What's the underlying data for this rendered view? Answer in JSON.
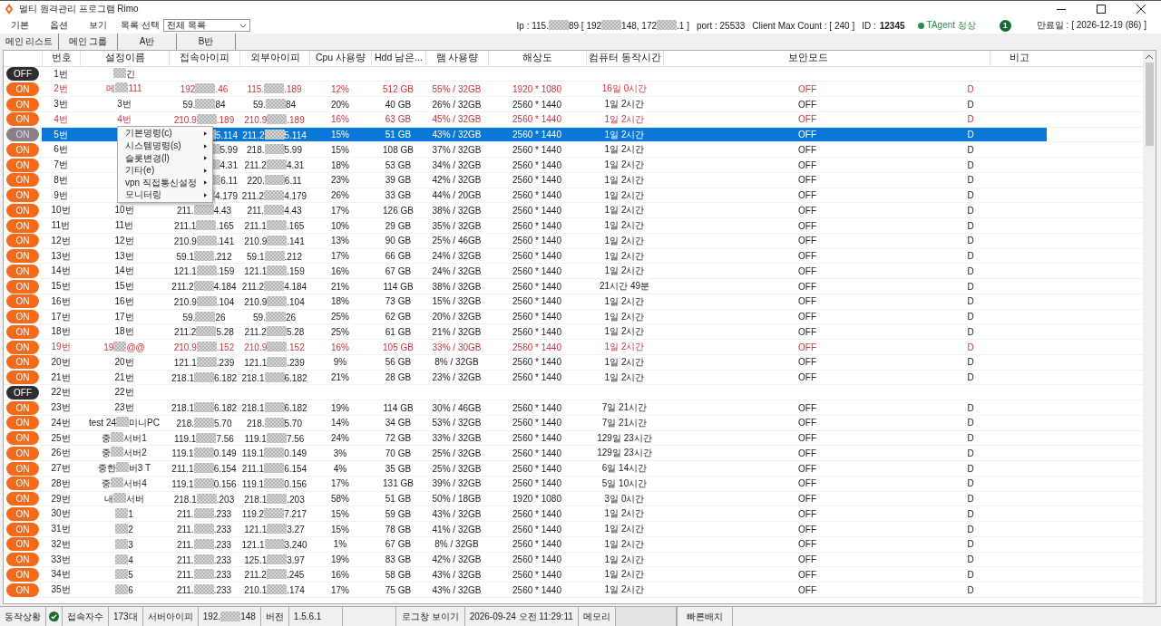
{
  "window": {
    "title": "멀티 원격관리 프로그램 Rimo"
  },
  "menu": [
    "기본",
    "옵션",
    "보기"
  ],
  "list_select": {
    "label": "목록 선택",
    "value": "전체 목록"
  },
  "info": {
    "ip": [
      "Ip : 115.",
      {
        "kind": "mask"
      },
      "89 [ 192",
      {
        "kind": "mask"
      },
      "148, 172",
      {
        "kind": "mask"
      },
      ".1 ]"
    ],
    "port": "port : 25533",
    "max_count": "Client Max Count :  [ 240 ]",
    "id_label": "ID :",
    "id": "12345",
    "agent": "TAgent 정상",
    "badge": "1",
    "expiry": "만료일 : [ 2026-12-19 (86) ]"
  },
  "tabs": [
    "메인 리스트",
    "메인 그룹",
    "A반",
    "B반"
  ],
  "columns": [
    {
      "kind": "blank"
    },
    {
      "kind": "text",
      "label": "번호"
    },
    {
      "kind": "text",
      "label": "설정이름"
    },
    {
      "kind": "text",
      "label": "접속아이피"
    },
    {
      "kind": "text",
      "label": "외부아이피"
    },
    {
      "kind": "text",
      "label": "Cpu 사용량"
    },
    {
      "kind": "text",
      "label": "Hdd 남은..."
    },
    {
      "kind": "text",
      "label": "램 사용량"
    },
    {
      "kind": "text",
      "label": "해상도"
    },
    {
      "kind": "text",
      "label": "컴퓨터 동작시간"
    },
    {
      "kind": "text",
      "label": "보안모드"
    },
    {
      "kind": "blank"
    },
    {
      "kind": "text",
      "label": "비고"
    }
  ],
  "rows": [
    {
      "status": "OFF",
      "on": false,
      "alert": false,
      "selected": false,
      "no": "1번",
      "name": [
        {
          "kind": "mask"
        },
        "긴"
      ]
    },
    {
      "status": "ON",
      "on": true,
      "alert": true,
      "selected": false,
      "no": "2번",
      "name": [
        "메",
        {
          "kind": "mask"
        },
        "111"
      ],
      "ip_local": [
        "192",
        {
          "kind": "mask"
        },
        ".46"
      ],
      "ip_external": [
        "115.",
        {
          "kind": "mask"
        },
        ".189"
      ],
      "cpu": "12%",
      "hdd": "512 GB",
      "ram": "55% / 32GB",
      "resolution": "1920 * 1080",
      "uptime": "16일 0시간",
      "security": "OFF",
      "column_12": "D"
    },
    {
      "status": "ON",
      "on": true,
      "alert": false,
      "selected": false,
      "no": "3번",
      "name": [
        "3번"
      ],
      "ip_local": [
        "59.",
        {
          "kind": "mask"
        },
        "84"
      ],
      "ip_external": [
        "59.",
        {
          "kind": "mask"
        },
        "84"
      ],
      "cpu": "20%",
      "hdd": "40 GB",
      "ram": "26% / 32GB",
      "resolution": "2560 * 1440",
      "uptime": "1일 2시간",
      "security": "OFF",
      "column_12": "D"
    },
    {
      "status": "ON",
      "on": true,
      "alert": true,
      "selected": false,
      "no": "4번",
      "name": [
        "4번"
      ],
      "ip_local": [
        "210.9",
        {
          "kind": "mask"
        },
        ".189"
      ],
      "ip_external": [
        "210.9",
        {
          "kind": "mask"
        },
        ".189"
      ],
      "cpu": "16%",
      "hdd": "63 GB",
      "ram": "45% / 32GB",
      "resolution": "2560 * 1440",
      "uptime": "1일 2시간",
      "security": "OFF",
      "column_12": "D"
    },
    {
      "status": "ON",
      "on": true,
      "alert": false,
      "selected": true,
      "no": "5번",
      "ip_local": [
        {
          "kind": "mask"
        },
        "5.114"
      ],
      "ip_external": [
        "211.2",
        {
          "kind": "mask"
        },
        "5.114"
      ],
      "cpu": "15%",
      "hdd": "51 GB",
      "ram": "43% / 32GB",
      "resolution": "2560 * 1440",
      "uptime": "1일 2시간",
      "security": "OFF",
      "column_12": "D"
    },
    {
      "status": "ON",
      "on": true,
      "alert": false,
      "selected": false,
      "no": "6번",
      "ip_local": [
        {
          "kind": "mask"
        },
        "5.99"
      ],
      "ip_external": [
        "218.",
        {
          "kind": "mask"
        },
        "5.99"
      ],
      "cpu": "15%",
      "hdd": "108 GB",
      "ram": "37% / 32GB",
      "resolution": "2560 * 1440",
      "uptime": "1일 2시간",
      "security": "OFF",
      "column_12": "D"
    },
    {
      "status": "ON",
      "on": true,
      "alert": false,
      "selected": false,
      "no": "7번",
      "ip_local": [
        {
          "kind": "mask"
        },
        "4.31"
      ],
      "ip_external": [
        "211.2",
        {
          "kind": "mask"
        },
        "4.31"
      ],
      "cpu": "18%",
      "hdd": "53 GB",
      "ram": "34% / 32GB",
      "resolution": "2560 * 1440",
      "uptime": "1일 2시간",
      "security": "OFF",
      "column_12": "D"
    },
    {
      "status": "ON",
      "on": true,
      "alert": false,
      "selected": false,
      "no": "8번",
      "ip_local": [
        {
          "kind": "mask"
        },
        "6.11"
      ],
      "ip_external": [
        "220.",
        {
          "kind": "mask"
        },
        "6.11"
      ],
      "cpu": "23%",
      "hdd": "39 GB",
      "ram": "42% / 32GB",
      "resolution": "2560 * 1440",
      "uptime": "1일 2시간",
      "security": "OFF",
      "column_12": "D"
    },
    {
      "status": "ON",
      "on": true,
      "alert": false,
      "selected": false,
      "no": "9번",
      "ip_local": [
        {
          "kind": "mask"
        },
        "4.179"
      ],
      "ip_external": [
        "211.2",
        {
          "kind": "mask"
        },
        "4.179"
      ],
      "cpu": "26%",
      "hdd": "33 GB",
      "ram": "44% / 20GB",
      "resolution": "2560 * 1440",
      "uptime": "1일 2시간",
      "security": "OFF",
      "column_12": "D"
    },
    {
      "status": "ON",
      "on": true,
      "alert": false,
      "selected": false,
      "no": "10번",
      "name": [
        "10번"
      ],
      "ip_local": [
        "211.",
        {
          "kind": "mask"
        },
        "4.43"
      ],
      "ip_external": [
        "211.",
        {
          "kind": "mask"
        },
        "4.43"
      ],
      "cpu": "17%",
      "hdd": "126 GB",
      "ram": "38% / 32GB",
      "resolution": "2560 * 1440",
      "uptime": "1일 2시간",
      "security": "OFF",
      "column_12": "D"
    },
    {
      "status": "ON",
      "on": true,
      "alert": false,
      "selected": false,
      "no": "11번",
      "name": [
        "11번"
      ],
      "ip_local": [
        "211.1",
        {
          "kind": "mask"
        },
        ".165"
      ],
      "ip_external": [
        "211.1",
        {
          "kind": "mask"
        },
        ".165"
      ],
      "cpu": "10%",
      "hdd": "29 GB",
      "ram": "35% / 32GB",
      "resolution": "2560 * 1440",
      "uptime": "1일 2시간",
      "security": "OFF",
      "column_12": "D"
    },
    {
      "status": "ON",
      "on": true,
      "alert": false,
      "selected": false,
      "no": "12번",
      "name": [
        "12번"
      ],
      "ip_local": [
        "210.9",
        {
          "kind": "mask"
        },
        ".141"
      ],
      "ip_external": [
        "210.9",
        {
          "kind": "mask"
        },
        ".141"
      ],
      "cpu": "13%",
      "hdd": "90 GB",
      "ram": "25% / 46GB",
      "resolution": "2560 * 1440",
      "uptime": "1일 2시간",
      "security": "OFF",
      "column_12": "D"
    },
    {
      "status": "ON",
      "on": true,
      "alert": false,
      "selected": false,
      "no": "13번",
      "name": [
        "13번"
      ],
      "ip_local": [
        "59.1",
        {
          "kind": "mask"
        },
        ".212"
      ],
      "ip_external": [
        "59.1",
        {
          "kind": "mask"
        },
        ".212"
      ],
      "cpu": "17%",
      "hdd": "66 GB",
      "ram": "24% / 32GB",
      "resolution": "2560 * 1440",
      "uptime": "1일 2시간",
      "security": "OFF",
      "column_12": "D"
    },
    {
      "status": "ON",
      "on": true,
      "alert": false,
      "selected": false,
      "no": "14번",
      "name": [
        "14번"
      ],
      "ip_local": [
        "121.1",
        {
          "kind": "mask"
        },
        ".159"
      ],
      "ip_external": [
        "121.1",
        {
          "kind": "mask"
        },
        ".159"
      ],
      "cpu": "16%",
      "hdd": "67 GB",
      "ram": "24% / 32GB",
      "resolution": "2560 * 1440",
      "uptime": "1일 2시간",
      "security": "OFF",
      "column_12": "D"
    },
    {
      "status": "ON",
      "on": true,
      "alert": false,
      "selected": false,
      "no": "15번",
      "name": [
        "15번"
      ],
      "ip_local": [
        "211.2",
        {
          "kind": "mask"
        },
        "4.184"
      ],
      "ip_external": [
        "211.2",
        {
          "kind": "mask"
        },
        "4.184"
      ],
      "cpu": "21%",
      "hdd": "114 GB",
      "ram": "38% / 32GB",
      "resolution": "2560 * 1440",
      "uptime": "21시간 49분",
      "security": "OFF",
      "column_12": "D"
    },
    {
      "status": "ON",
      "on": true,
      "alert": false,
      "selected": false,
      "no": "16번",
      "name": [
        "16번"
      ],
      "ip_local": [
        "210.9",
        {
          "kind": "mask"
        },
        ".104"
      ],
      "ip_external": [
        "210.9",
        {
          "kind": "mask"
        },
        ".104"
      ],
      "cpu": "18%",
      "hdd": "73 GB",
      "ram": "15% / 32GB",
      "resolution": "2560 * 1440",
      "uptime": "1일 2시간",
      "security": "OFF",
      "column_12": "D"
    },
    {
      "status": "ON",
      "on": true,
      "alert": false,
      "selected": false,
      "no": "17번",
      "name": [
        "17번"
      ],
      "ip_local": [
        "59.",
        {
          "kind": "mask"
        },
        "26"
      ],
      "ip_external": [
        "59.",
        {
          "kind": "mask"
        },
        "26"
      ],
      "cpu": "25%",
      "hdd": "62 GB",
      "ram": "20% / 32GB",
      "resolution": "2560 * 1440",
      "uptime": "1일 2시간",
      "security": "OFF",
      "column_12": "D"
    },
    {
      "status": "ON",
      "on": true,
      "alert": false,
      "selected": false,
      "no": "18번",
      "name": [
        "18번"
      ],
      "ip_local": [
        "211.2",
        {
          "kind": "mask"
        },
        "5.28"
      ],
      "ip_external": [
        "211.2",
        {
          "kind": "mask"
        },
        "5.28"
      ],
      "cpu": "25%",
      "hdd": "61 GB",
      "ram": "21% / 32GB",
      "resolution": "2560 * 1440",
      "uptime": "1일 2시간",
      "security": "OFF",
      "column_12": "D"
    },
    {
      "status": "ON",
      "on": true,
      "alert": true,
      "selected": false,
      "no": "19번",
      "name": [
        "19",
        {
          "kind": "mask"
        },
        "@@"
      ],
      "ip_local": [
        "210.9",
        {
          "kind": "mask"
        },
        ".152"
      ],
      "ip_external": [
        "210.9",
        {
          "kind": "mask"
        },
        ".152"
      ],
      "cpu": "16%",
      "hdd": "105 GB",
      "ram": "33% / 30GB",
      "resolution": "2560 * 1440",
      "uptime": "1일 2시간",
      "security": "OFF",
      "column_12": "D"
    },
    {
      "status": "ON",
      "on": true,
      "alert": false,
      "selected": false,
      "no": "20번",
      "name": [
        "20번"
      ],
      "ip_local": [
        "121.1",
        {
          "kind": "mask"
        },
        ".239"
      ],
      "ip_external": [
        "121.1",
        {
          "kind": "mask"
        },
        ".239"
      ],
      "cpu": "9%",
      "hdd": "56 GB",
      "ram": "8% / 32GB",
      "resolution": "2560 * 1440",
      "uptime": "1일 2시간",
      "security": "OFF",
      "column_12": "D"
    },
    {
      "status": "ON",
      "on": true,
      "alert": false,
      "selected": false,
      "no": "21번",
      "name": [
        "21번"
      ],
      "ip_local": [
        "218.1",
        {
          "kind": "mask"
        },
        "6.182"
      ],
      "ip_external": [
        "218.1",
        {
          "kind": "mask"
        },
        "6.182"
      ],
      "cpu": "21%",
      "hdd": "28 GB",
      "ram": "23% / 32GB",
      "resolution": "2560 * 1440",
      "uptime": "1일 2시간",
      "security": "OFF",
      "column_12": "D"
    },
    {
      "status": "OFF",
      "on": false,
      "alert": false,
      "selected": false,
      "no": "22번",
      "name": [
        "22번"
      ]
    },
    {
      "status": "ON",
      "on": true,
      "alert": false,
      "selected": false,
      "no": "23번",
      "name": [
        "23번"
      ],
      "ip_local": [
        "218.1",
        {
          "kind": "mask"
        },
        "6.182"
      ],
      "ip_external": [
        "218.1",
        {
          "kind": "mask"
        },
        "6.182"
      ],
      "cpu": "19%",
      "hdd": "114 GB",
      "ram": "30% / 46GB",
      "resolution": "2560 * 1440",
      "uptime": "7일 21시간",
      "security": "OFF",
      "column_12": "D"
    },
    {
      "status": "ON",
      "on": true,
      "alert": false,
      "selected": false,
      "no": "24번",
      "name": [
        "test 24",
        {
          "kind": "mask"
        },
        "미니PC"
      ],
      "ip_local": [
        "218.",
        {
          "kind": "mask"
        },
        "5.70"
      ],
      "ip_external": [
        "218.",
        {
          "kind": "mask"
        },
        "5.70"
      ],
      "cpu": "14%",
      "hdd": "34 GB",
      "ram": "53% / 32GB",
      "resolution": "2560 * 1440",
      "uptime": "7일 21시간",
      "security": "OFF",
      "column_12": "D"
    },
    {
      "status": "ON",
      "on": true,
      "alert": false,
      "selected": false,
      "no": "25번",
      "name": [
        "중",
        {
          "kind": "mask"
        },
        "서버1"
      ],
      "ip_local": [
        "119.1",
        {
          "kind": "mask"
        },
        "7.56"
      ],
      "ip_external": [
        "119.1",
        {
          "kind": "mask"
        },
        "7.56"
      ],
      "cpu": "24%",
      "hdd": "72 GB",
      "ram": "33% / 32GB",
      "resolution": "2560 * 1440",
      "uptime": "129일 23시간",
      "security": "OFF",
      "column_12": "D"
    },
    {
      "status": "ON",
      "on": true,
      "alert": false,
      "selected": false,
      "no": "26번",
      "name": [
        "중",
        {
          "kind": "mask"
        },
        "서버2"
      ],
      "ip_local": [
        "119.1",
        {
          "kind": "mask"
        },
        "0.149"
      ],
      "ip_external": [
        "119.1",
        {
          "kind": "mask"
        },
        "0.149"
      ],
      "cpu": "3%",
      "hdd": "70 GB",
      "ram": "25% / 32GB",
      "resolution": "2560 * 1440",
      "uptime": "129일 23시간",
      "security": "OFF",
      "column_12": "D"
    },
    {
      "status": "ON",
      "on": true,
      "alert": false,
      "selected": false,
      "no": "27번",
      "name": [
        "중한",
        {
          "kind": "mask"
        },
        "버3 T"
      ],
      "ip_local": [
        "211.1",
        {
          "kind": "mask"
        },
        "6.154"
      ],
      "ip_external": [
        "211.1",
        {
          "kind": "mask"
        },
        "6.154"
      ],
      "cpu": "4%",
      "hdd": "35 GB",
      "ram": "25% / 32GB",
      "resolution": "2560 * 1440",
      "uptime": "6일 14시간",
      "security": "OFF",
      "column_12": "D"
    },
    {
      "status": "ON",
      "on": true,
      "alert": false,
      "selected": false,
      "no": "28번",
      "name": [
        "중",
        {
          "kind": "mask"
        },
        "서버4"
      ],
      "ip_local": [
        "119.1",
        {
          "kind": "mask"
        },
        "0.156"
      ],
      "ip_external": [
        "119.1",
        {
          "kind": "mask"
        },
        "0.156"
      ],
      "cpu": "17%",
      "hdd": "131 GB",
      "ram": "39% / 32GB",
      "resolution": "2560 * 1440",
      "uptime": "5일 10시간",
      "security": "OFF",
      "column_12": "D"
    },
    {
      "status": "ON",
      "on": true,
      "alert": false,
      "selected": false,
      "no": "29번",
      "name": [
        "내",
        {
          "kind": "mask"
        },
        "서버"
      ],
      "ip_local": [
        "218.1",
        {
          "kind": "mask"
        },
        ".203"
      ],
      "ip_external": [
        "218.1",
        {
          "kind": "mask"
        },
        ".203"
      ],
      "cpu": "58%",
      "hdd": "51 GB",
      "ram": "50% / 18GB",
      "resolution": "1920 * 1080",
      "uptime": "3일 0시간",
      "security": "OFF",
      "column_12": "D"
    },
    {
      "status": "ON",
      "on": true,
      "alert": false,
      "selected": false,
      "no": "30번",
      "name": [
        {
          "kind": "mask"
        },
        "1"
      ],
      "ip_local": [
        "211.",
        {
          "kind": "mask"
        },
        ".233"
      ],
      "ip_external": [
        "119.2",
        {
          "kind": "mask"
        },
        "7.217"
      ],
      "cpu": "15%",
      "hdd": "59 GB",
      "ram": "43% / 32GB",
      "resolution": "2560 * 1440",
      "uptime": "1일 2시간",
      "security": "OFF",
      "column_12": "D"
    },
    {
      "status": "ON",
      "on": true,
      "alert": false,
      "selected": false,
      "no": "31번",
      "name": [
        {
          "kind": "mask"
        },
        "2"
      ],
      "ip_local": [
        "211.",
        {
          "kind": "mask"
        },
        ".233"
      ],
      "ip_external": [
        "121.1",
        {
          "kind": "mask"
        },
        "3.27"
      ],
      "cpu": "15%",
      "hdd": "78 GB",
      "ram": "41% / 32GB",
      "resolution": "2560 * 1440",
      "uptime": "1일 2시간",
      "security": "OFF",
      "column_12": "D"
    },
    {
      "status": "ON",
      "on": true,
      "alert": false,
      "selected": false,
      "no": "32번",
      "name": [
        {
          "kind": "mask"
        },
        "3"
      ],
      "ip_local": [
        "211.",
        {
          "kind": "mask"
        },
        ".233"
      ],
      "ip_external": [
        "121.1",
        {
          "kind": "mask"
        },
        "3.240"
      ],
      "cpu": "1%",
      "hdd": "67 GB",
      "ram": "8% / 32GB",
      "resolution": "2560 * 1440",
      "uptime": "1일 2시간",
      "security": "OFF",
      "column_12": "D"
    },
    {
      "status": "ON",
      "on": true,
      "alert": false,
      "selected": false,
      "no": "33번",
      "name": [
        {
          "kind": "mask"
        },
        "4"
      ],
      "ip_local": [
        "211.",
        {
          "kind": "mask"
        },
        ".233"
      ],
      "ip_external": [
        "125.1",
        {
          "kind": "mask"
        },
        "3.97"
      ],
      "cpu": "19%",
      "hdd": "83 GB",
      "ram": "42% / 32GB",
      "resolution": "2560 * 1440",
      "uptime": "1일 2시간",
      "security": "OFF",
      "column_12": "D"
    },
    {
      "status": "ON",
      "on": true,
      "alert": false,
      "selected": false,
      "no": "34번",
      "name": [
        {
          "kind": "mask"
        },
        "5"
      ],
      "ip_local": [
        "211.",
        {
          "kind": "mask"
        },
        ".233"
      ],
      "ip_external": [
        "211.2",
        {
          "kind": "mask"
        },
        ".245"
      ],
      "cpu": "16%",
      "hdd": "58 GB",
      "ram": "43% / 32GB",
      "resolution": "2560 * 1440",
      "uptime": "1일 2시간",
      "security": "OFF",
      "column_12": "D"
    },
    {
      "status": "ON",
      "on": true,
      "alert": false,
      "selected": false,
      "no": "35번",
      "name": [
        {
          "kind": "mask"
        },
        "6"
      ],
      "ip_local": [
        "211.",
        {
          "kind": "mask"
        },
        ".233"
      ],
      "ip_external": [
        "210.1",
        {
          "kind": "mask"
        },
        ".174"
      ],
      "cpu": "17%",
      "hdd": "75 GB",
      "ram": "43% / 32GB",
      "resolution": "2560 * 1440",
      "uptime": "1일 2시간",
      "security": "OFF",
      "column_12": "D"
    }
  ],
  "context_menu": [
    "기본명령(c)",
    "시스템명령(s)",
    "슬롯변경(l)",
    "기타(e)",
    "vpn 직접통신설정",
    "모니터링"
  ],
  "status_bar": {
    "state_label": "동작상황",
    "users_label": "접속자수",
    "users": "173대",
    "server_ip_label": "서버아이피",
    "server_ip": [
      "192.",
      {
        "kind": "mask"
      },
      "148"
    ],
    "version_label": "버전",
    "version": "1.5.6.1",
    "log_button": "로그창 보이기",
    "datetime": "2026-09-24 오전 11:29:11",
    "memory_label": "메모리",
    "quick_button": "빠른배치"
  }
}
